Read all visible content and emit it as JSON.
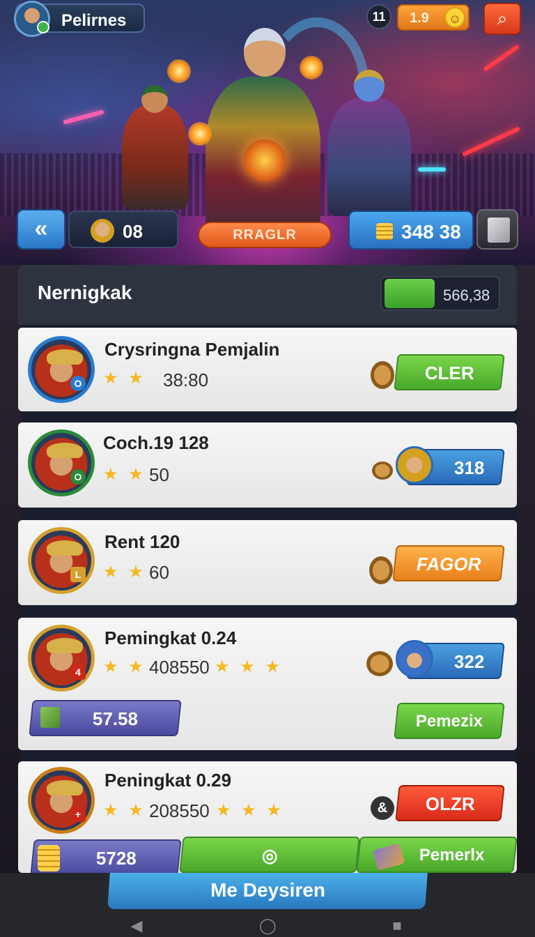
{
  "header": {
    "profile_name": "Pelirnes",
    "level": "11",
    "currency_value": "1.9",
    "currency_face": "☺",
    "search_icon": "⌕"
  },
  "hud": {
    "back_icon": "«",
    "players_value": "08",
    "main_action": "RRAGLR",
    "gold_value": "348 38"
  },
  "panel": {
    "title": "Nernigkak",
    "score": "566,38"
  },
  "cards": [
    {
      "name": "Crysringna Pemjalin",
      "stars": "★ ★",
      "stat": "38:80",
      "button": "CLER",
      "avatar_tag": "O"
    },
    {
      "name": "Coch.19 128",
      "stars": "★ ★",
      "stat": "50",
      "button": "318",
      "avatar_tag": "O"
    },
    {
      "name": "Rent 120",
      "stars": "★ ★",
      "stat": "60",
      "button": "FAGOR",
      "avatar_tag": "L"
    },
    {
      "name": "Pemingkat 0.24",
      "stars": "★ ★",
      "stat": "408550",
      "stars_right": "★ ★ ★",
      "button": "322",
      "sub_left": "57.58",
      "sub_right": "Pemezix",
      "avatar_tag": "4"
    },
    {
      "name": "Peningkat 0.29",
      "stars": "★ ★",
      "stat": "208550",
      "stars_right": "★ ★ ★",
      "button": "OLZR",
      "sub_left": "5728",
      "sub_right": "Pemerlx",
      "and_icon": "&",
      "avatar_tag": "+"
    }
  ],
  "bottom": {
    "cta": "Me Deysiren",
    "nav_back": "◀",
    "nav_home": "◯",
    "nav_recent": "■"
  },
  "colors": {
    "accent_blue": "#2a78c0",
    "accent_green": "#4aa82a",
    "accent_orange": "#e8801a",
    "accent_red": "#d82a1a"
  }
}
